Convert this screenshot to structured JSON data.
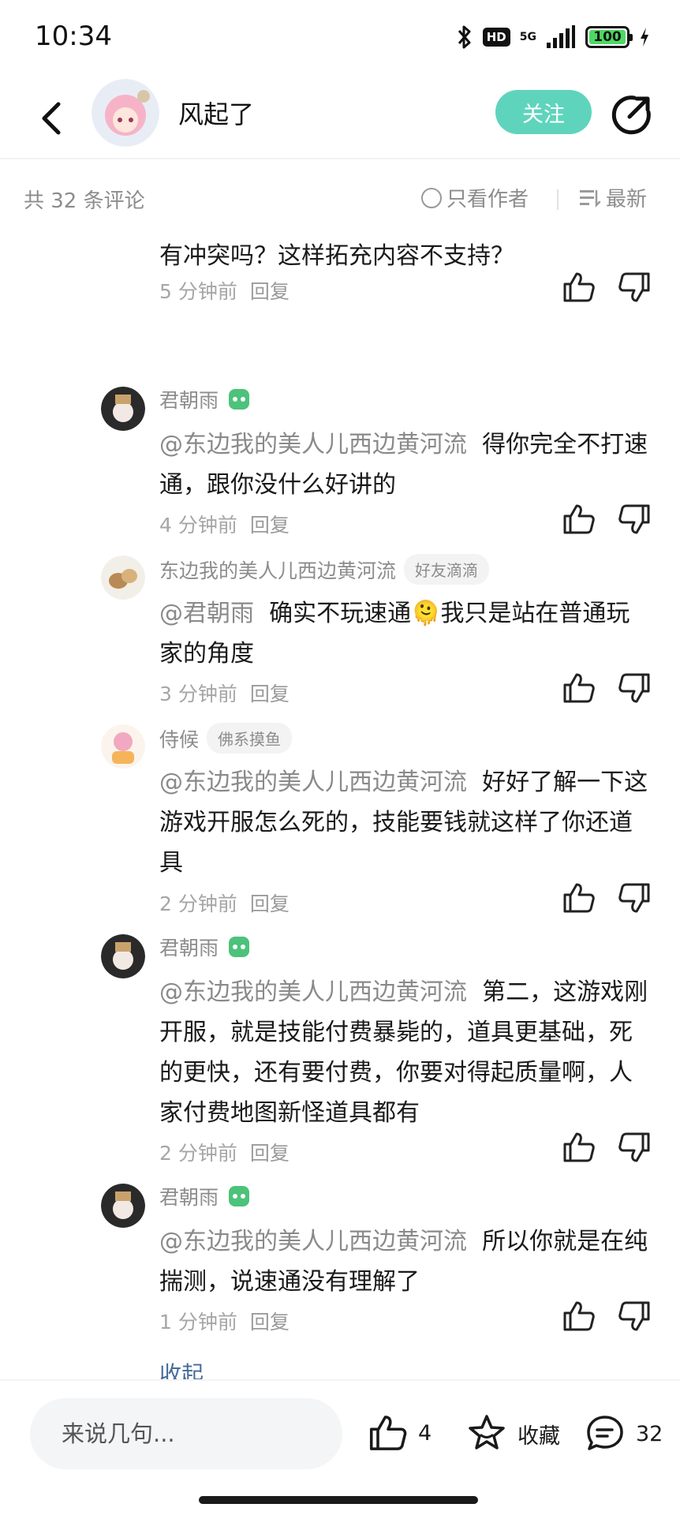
{
  "status_bar": {
    "time": "10:34",
    "hd": "HD",
    "network": "5G",
    "battery": "100"
  },
  "header": {
    "author_name": "风起了",
    "follow_label": "关注"
  },
  "filter": {
    "count_text": "共 32 条评论",
    "author_only_label": "只看作者",
    "sort_label": "最新"
  },
  "comments": [
    {
      "text": "本更新了，大量新道具新玩法更新，这和速通有冲突吗？这样拓充内容不支持？",
      "time": "5 分钟前",
      "reply_label": "回复"
    },
    {
      "user": "君朝雨",
      "mention": "@东边我的美人儿西边黄河流",
      "text": "得你完全不打速通，跟你没什么好讲的",
      "time": "4 分钟前",
      "reply_label": "回复"
    },
    {
      "user": "东边我的美人儿西边黄河流",
      "tag": "好友滴滴",
      "mention": "@君朝雨",
      "text_before_emoji": "确实不玩速通",
      "emoji": "🫠",
      "text_after_emoji": "我只是站在普通玩家的角度",
      "time": "3 分钟前",
      "reply_label": "回复"
    },
    {
      "user": "侍候",
      "tag": "佛系摸鱼",
      "mention": "@东边我的美人儿西边黄河流",
      "text": "好好了解一下这游戏开服怎么死的，技能要钱就这样了你还道具",
      "time": "2 分钟前",
      "reply_label": "回复"
    },
    {
      "user": "君朝雨",
      "mention": "@东边我的美人儿西边黄河流",
      "text": "第二，这游戏刚开服，就是技能付费暴毙的，道具更基础，死的更快，还有要付费，你要对得起质量啊，人家付费地图新怪道具都有",
      "time": "2 分钟前",
      "reply_label": "回复"
    },
    {
      "user": "君朝雨",
      "mention": "@东边我的美人儿西边黄河流",
      "text": "所以你就是在纯揣测，说速通没有理解了",
      "time": "1 分钟前",
      "reply_label": "回复"
    }
  ],
  "collapse_label": "收起",
  "bottom_bar": {
    "input_placeholder": "来说几句...",
    "like_count": "4",
    "favorite_label": "收藏",
    "comment_count": "32"
  },
  "colors": {
    "accent": "#5fd4bc",
    "muted_text": "#8c8c8c",
    "link": "#456a9a",
    "badge_green": "#4cc27a"
  },
  "icons": [
    "back-arrow-icon",
    "share-icon",
    "thumb-up-icon",
    "thumb-down-icon",
    "game-badge-icon",
    "sort-list-icon",
    "star-icon",
    "comment-bubble-icon",
    "bluetooth-icon",
    "signal-icon",
    "charging-icon"
  ]
}
